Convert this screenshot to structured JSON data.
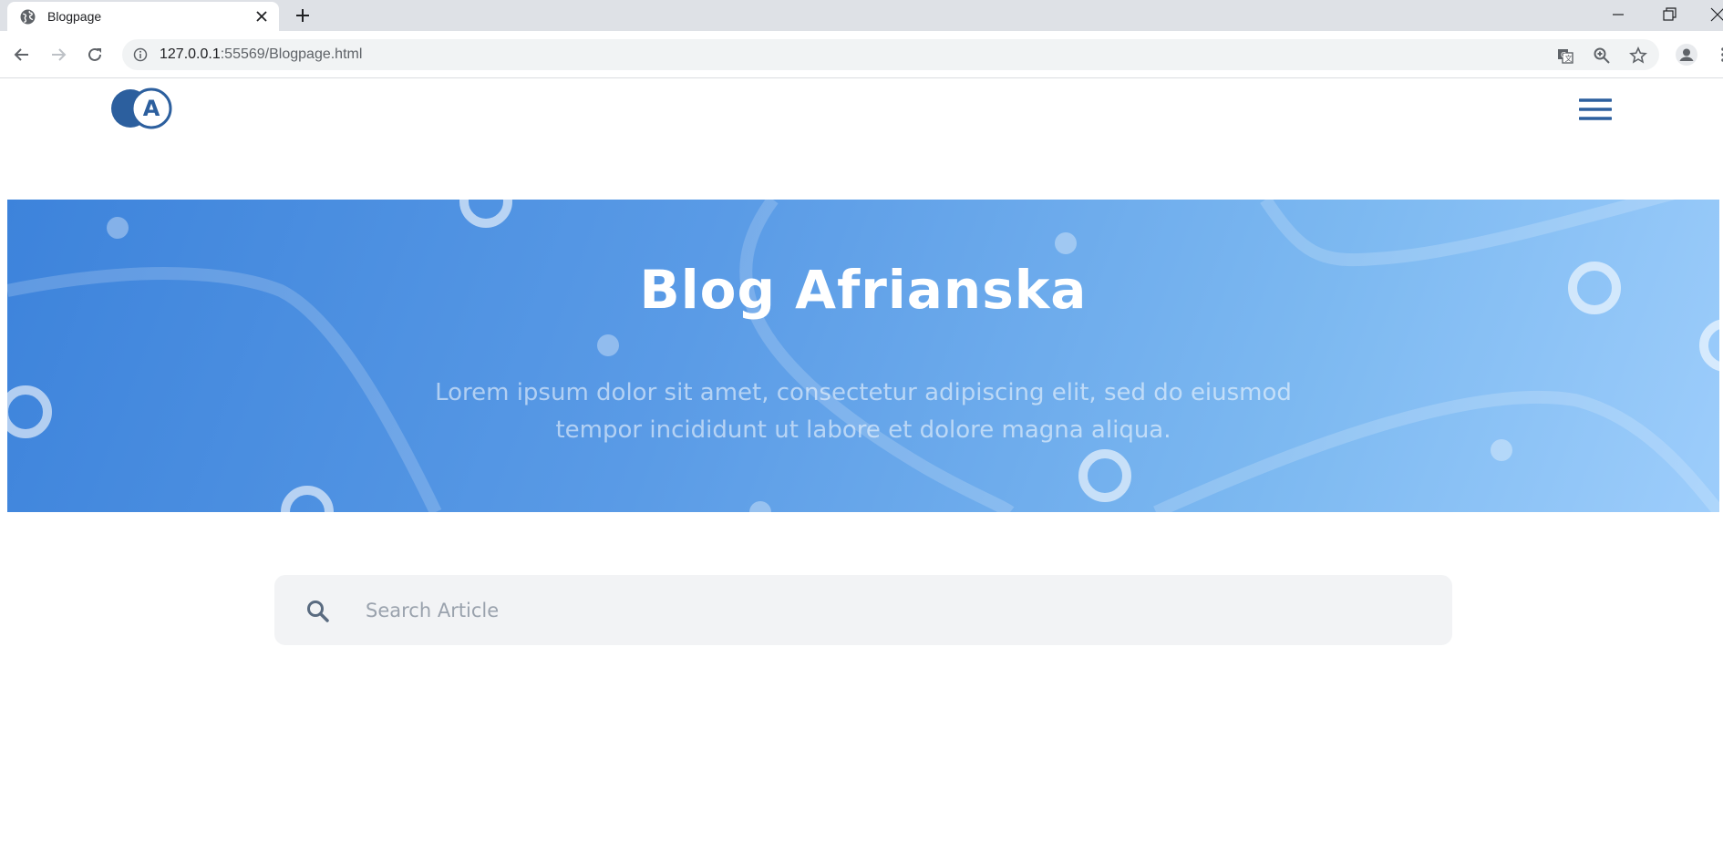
{
  "browser": {
    "tab_title": "Blogpage",
    "url_host": "127.0.0.1",
    "url_rest": ":55569/Blogpage.html"
  },
  "site": {
    "logo_letter": "A",
    "brand_color": "#2c5f9e"
  },
  "hero": {
    "title": "Blog Afrianska",
    "subtitle": "Lorem ipsum dolor sit amet, consectetur adipiscing elit, sed do eiusmod tempor incididunt ut labore et dolore magna aliqua."
  },
  "search": {
    "placeholder": "Search Article",
    "value": ""
  },
  "icons": {
    "tab_favicon": "globe-icon",
    "search": "search-icon",
    "menu": "hamburger-menu-icon"
  }
}
